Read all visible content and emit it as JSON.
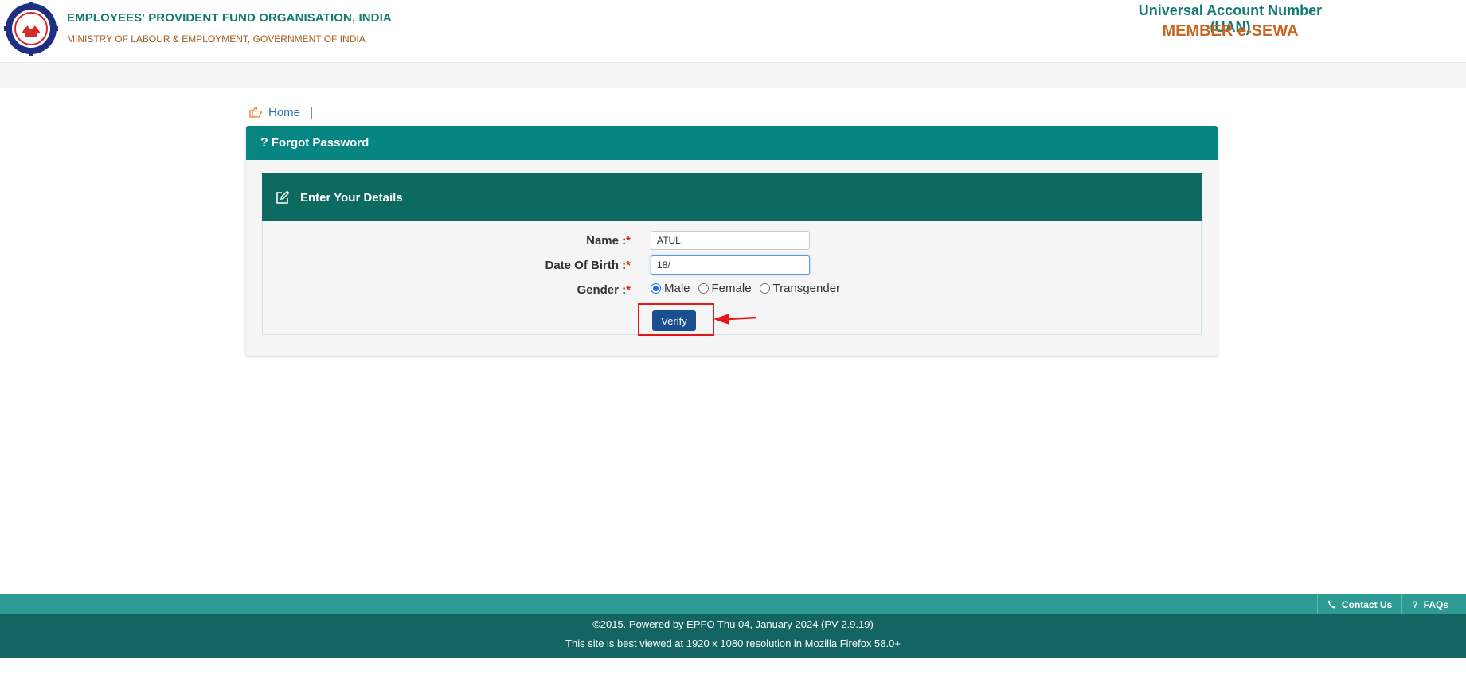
{
  "header": {
    "org_name": "EMPLOYEES' PROVIDENT FUND ORGANISATION, INDIA",
    "ministry": "MINISTRY OF LABOUR & EMPLOYMENT, GOVERNMENT OF INDIA",
    "uan_title": "Universal Account Number (UAN)",
    "service_title": "MEMBER e-SEWA"
  },
  "breadcrumb": {
    "home_label": "Home",
    "separator": "|"
  },
  "panel": {
    "title": "Forgot Password",
    "section_title": "Enter Your Details"
  },
  "form": {
    "name_label": "Name :",
    "name_value": "ATUL",
    "dob_label": "Date Of Birth :",
    "dob_value": "18/",
    "gender_label": "Gender :",
    "required_mark": "*",
    "gender_options": [
      "Male",
      "Female",
      "Transgender"
    ],
    "gender_selected": "Male",
    "verify_label": "Verify"
  },
  "footer": {
    "contact_label": "Contact Us",
    "faq_label": "FAQs",
    "copyright": "©2015. Powered by EPFO Thu 04, January 2024 (PV 2.9.19)",
    "best_viewed": "This site is best viewed at 1920 x 1080 resolution in Mozilla Firefox 58.0+"
  },
  "colors": {
    "teal_header": "#078582",
    "dark_teal": "#0c6a60",
    "brand_orange": "#c8651f",
    "verify_button": "#1a4f8f",
    "highlight_red": "#e01818"
  }
}
